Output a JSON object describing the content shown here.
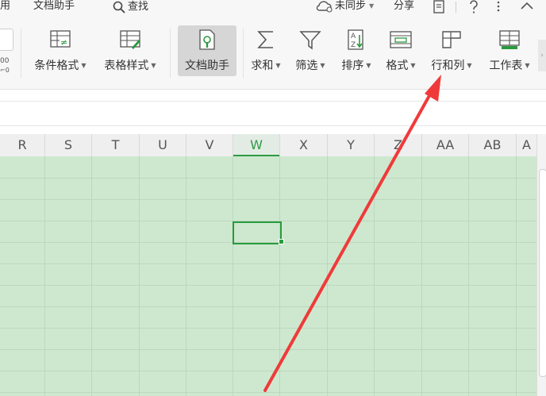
{
  "menu": {
    "left_item": "用",
    "doc_helper": "文档助手",
    "search_label": "查找",
    "sync_label": "未同步",
    "share_label": "分享"
  },
  "ribbon": {
    "left_stub_number": "00",
    "buttons": [
      {
        "id": "conditional-format",
        "label": "条件格式",
        "icon": "conditional-format-icon",
        "dropdown": true
      },
      {
        "id": "table-style",
        "label": "表格样式",
        "icon": "table-style-icon",
        "dropdown": true
      },
      {
        "id": "doc-helper",
        "label": "文档助手",
        "icon": "doc-helper-icon",
        "dropdown": false,
        "active": true
      },
      {
        "id": "sum",
        "label": "求和",
        "icon": "sigma-icon",
        "dropdown": true
      },
      {
        "id": "filter",
        "label": "筛选",
        "icon": "filter-icon",
        "dropdown": true
      },
      {
        "id": "sort",
        "label": "排序",
        "icon": "sort-icon",
        "dropdown": true
      },
      {
        "id": "format",
        "label": "格式",
        "icon": "format-icon",
        "dropdown": true
      },
      {
        "id": "rows-cols",
        "label": "行和列",
        "icon": "rows-columns-icon",
        "dropdown": true
      },
      {
        "id": "worksheet",
        "label": "工作表",
        "icon": "worksheet-icon",
        "dropdown": true
      }
    ]
  },
  "sheet": {
    "columns": [
      "R",
      "S",
      "T",
      "U",
      "V",
      "W",
      "X",
      "Y",
      "Z",
      "AA",
      "AB",
      "A"
    ],
    "selected_column": "W"
  },
  "colors": {
    "grid_fill": "#cde8cf",
    "accent_green": "#2a9a3d",
    "arrow_red": "#f03a3a"
  }
}
